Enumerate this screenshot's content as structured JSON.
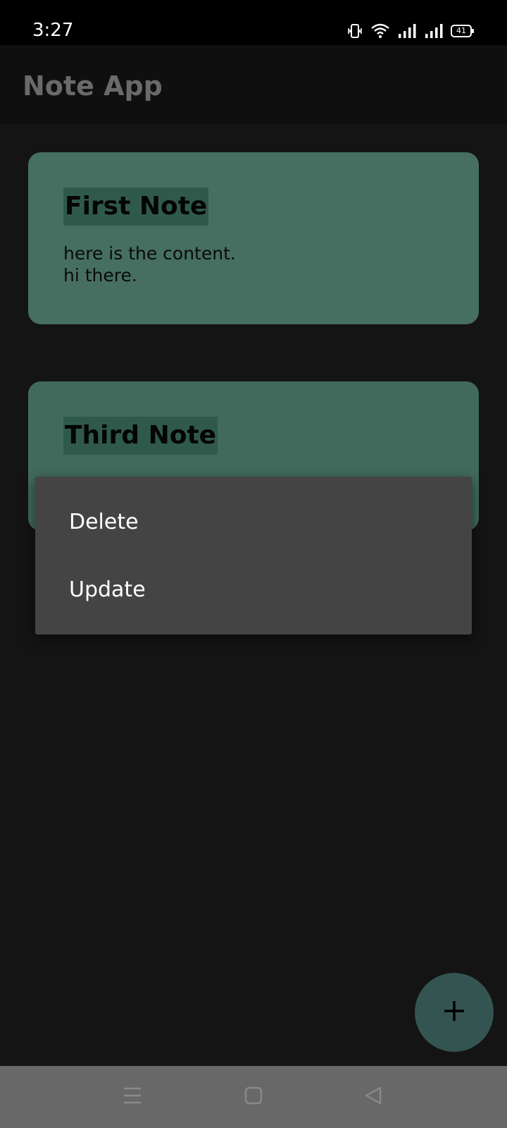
{
  "status_bar": {
    "time": "3:27",
    "battery": "41",
    "icons": [
      "vibrate-icon",
      "wifi-icon",
      "signal-icon",
      "signal-icon",
      "battery-icon"
    ]
  },
  "app_bar": {
    "title": "Note App"
  },
  "notes": [
    {
      "title": "First Note",
      "content": "here is the content.\nhi there."
    },
    {
      "title": "Third Note",
      "content": ""
    }
  ],
  "context_menu": {
    "items": [
      {
        "label": "Delete"
      },
      {
        "label": "Update"
      }
    ]
  },
  "fab": {
    "icon": "plus-icon"
  },
  "nav_bar": {
    "icons": [
      "menu-icon",
      "home-icon",
      "back-icon"
    ]
  },
  "colors": {
    "card": "#466f61",
    "title_highlight": "#2f5a4b",
    "menu_bg": "#444444",
    "fab_bg": "#345451",
    "nav_bg": "#686868"
  }
}
